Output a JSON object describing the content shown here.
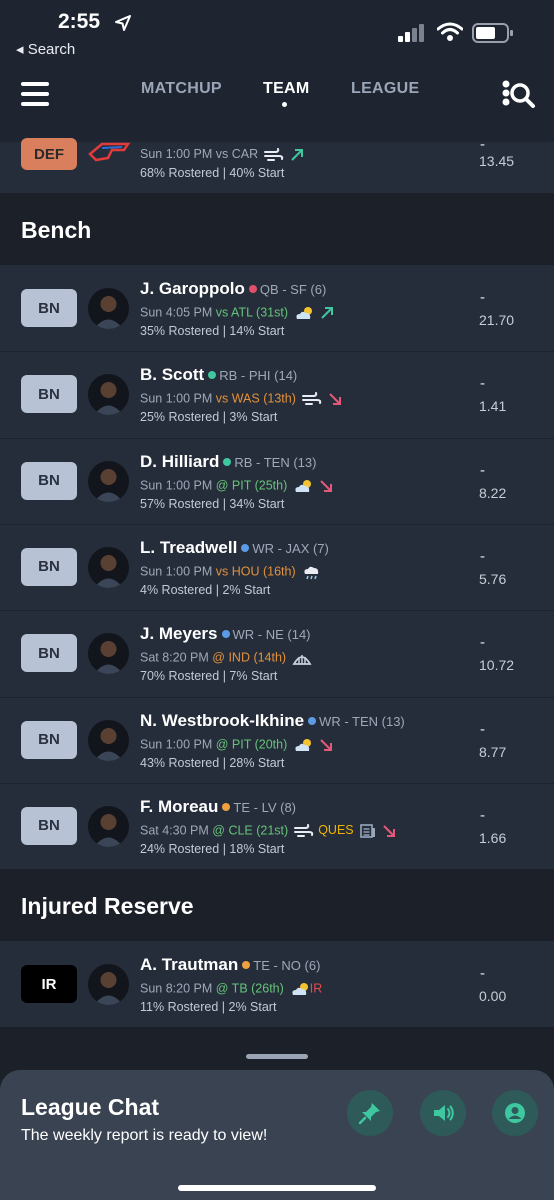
{
  "status_bar": {
    "time": "2:55",
    "back_label": "◂ Search"
  },
  "nav": {
    "tabs": [
      {
        "label": "MATCHUP",
        "active": false
      },
      {
        "label": "TEAM",
        "active": true
      },
      {
        "label": "LEAGUE",
        "active": false
      }
    ]
  },
  "def_row": {
    "slot": "DEF",
    "game": "Sun 1:00 PM vs CAR",
    "rostered": "68% Rostered",
    "start": "40% Start",
    "score_dash": "-",
    "score": "13.45"
  },
  "sections": {
    "bench": "Bench",
    "injured_reserve": "Injured Reserve"
  },
  "bench": [
    {
      "slot": "BN",
      "name": "J. Garoppolo",
      "pos": "QB - SF (6)",
      "pos_color": "#e0506b",
      "time": "Sun 4:05 PM",
      "opp": "vs ATL (31st)",
      "opp_class": "opp-green",
      "weather": "cloud-sun",
      "trend": "up",
      "rostered": "35% Rostered",
      "start": "14% Start",
      "score_dash": "-",
      "score": "21.70"
    },
    {
      "slot": "BN",
      "name": "B. Scott",
      "pos": "RB - PHI (14)",
      "pos_color": "#3fc7a0",
      "time": "Sun 1:00 PM",
      "opp": "vs WAS (13th)",
      "opp_class": "opp-orange",
      "weather": "wind",
      "trend": "down",
      "rostered": "25% Rostered",
      "start": "3% Start",
      "score_dash": "-",
      "score": "1.41"
    },
    {
      "slot": "BN",
      "name": "D. Hilliard",
      "pos": "RB - TEN (13)",
      "pos_color": "#3fc7a0",
      "time": "Sun 1:00 PM",
      "opp": "@ PIT (25th)",
      "opp_class": "opp-green",
      "weather": "cloud-sun",
      "trend": "down",
      "rostered": "57% Rostered",
      "start": "34% Start",
      "score_dash": "-",
      "score": "8.22"
    },
    {
      "slot": "BN",
      "name": "L. Treadwell",
      "pos": "WR - JAX (7)",
      "pos_color": "#5b9be6",
      "time": "Sun 1:00 PM",
      "opp": "vs HOU (16th)",
      "opp_class": "opp-orange",
      "weather": "cloud-rain",
      "trend": "",
      "rostered": "4% Rostered",
      "start": "2% Start",
      "score_dash": "-",
      "score": "5.76"
    },
    {
      "slot": "BN",
      "name": "J. Meyers",
      "pos": "WR - NE (14)",
      "pos_color": "#5b9be6",
      "time": "Sat 8:20 PM",
      "opp": "@ IND (14th)",
      "opp_class": "opp-orange",
      "weather": "dome",
      "trend": "",
      "rostered": "70% Rostered",
      "start": "7% Start",
      "score_dash": "-",
      "score": "10.72"
    },
    {
      "slot": "BN",
      "name": "N. Westbrook-Ikhine",
      "pos": "WR - TEN (13)",
      "pos_color": "#5b9be6",
      "time": "Sun 1:00 PM",
      "opp": "@ PIT (20th)",
      "opp_class": "opp-green",
      "weather": "cloud-sun",
      "trend": "down",
      "rostered": "43% Rostered",
      "start": "28% Start",
      "score_dash": "-",
      "score": "8.77"
    },
    {
      "slot": "BN",
      "name": "F. Moreau",
      "pos": "TE - LV (8)",
      "pos_color": "#f0a040",
      "time": "Sat 4:30 PM",
      "opp": "@ CLE (21st)",
      "opp_class": "opp-green",
      "weather": "wind",
      "status": "QUES",
      "trend": "down",
      "rostered": "24% Rostered",
      "start": "18% Start",
      "score_dash": "-",
      "score": "1.66"
    }
  ],
  "ir": [
    {
      "slot": "IR",
      "name": "A. Trautman",
      "pos": "TE - NO (6)",
      "pos_color": "#f0a040",
      "time": "Sun 8:20 PM",
      "opp": "@ TB (26th)",
      "opp_class": "opp-green",
      "weather": "cloud-sun",
      "status": "IR",
      "rostered": "11% Rostered",
      "start": "2% Start",
      "score_dash": "-",
      "score": "0.00"
    }
  ],
  "chat": {
    "title": "League Chat",
    "subtitle": "The weekly report is ready to view!"
  }
}
